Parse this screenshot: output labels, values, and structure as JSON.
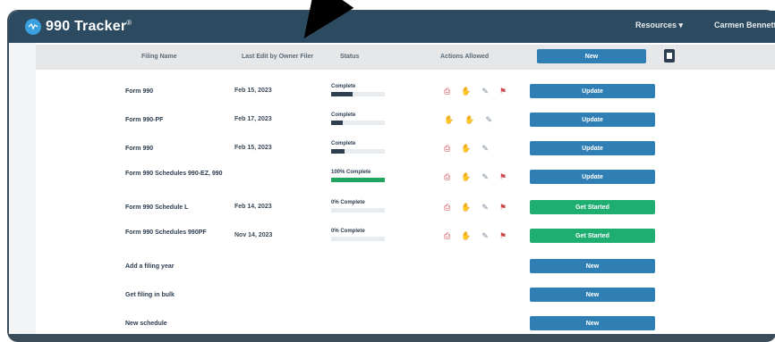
{
  "app": {
    "title": "990 Tracker",
    "registered_mark": "®"
  },
  "nav": {
    "resources": "Resources ▾",
    "account": "Carmen Bennett ▾"
  },
  "table": {
    "headers": [
      "Filing Name",
      "Last Edit by Owner Filer",
      "Status",
      "Actions Allowed",
      ""
    ],
    "header_button": "New",
    "rows": [
      {
        "form": "Form 990",
        "date": "Feb 15, 2023",
        "status": "Complete",
        "progress": 0.4,
        "progress_color": "#2c3e50",
        "icons": [
          "pdf-icon",
          "hand-icon",
          "edit-icon",
          "flag-icon"
        ],
        "action": "Update",
        "action_color": "#2f7fb4"
      },
      {
        "form": "Form 990-PF",
        "date": "Feb 17, 2023",
        "status": "Complete",
        "progress": 0.22,
        "progress_color": "#2c3e50",
        "icons": [
          "hand-icon",
          "hand-icon",
          "edit-icon"
        ],
        "action": "Update",
        "action_color": "#2f7fb4"
      },
      {
        "form": "Form 990",
        "date": "Feb 15, 2023",
        "status": "Complete",
        "progress": 0.25,
        "progress_color": "#2c3e50",
        "icons": [
          "pdf-icon",
          "hand-icon",
          "edit-icon"
        ],
        "action": "Update",
        "action_color": "#2f7fb4"
      },
      {
        "form": "Form 990 Schedules 990-EZ, 990",
        "date": "",
        "status": "100% Complete",
        "progress": 1.0,
        "progress_color": "#22a65f",
        "icons": [
          "pdf-icon",
          "hand-icon",
          "edit-icon",
          "flag-icon"
        ],
        "action": "Update",
        "action_color": "#2f7fb4"
      },
      {
        "form": "Form 990 Schedule L",
        "date": "Feb 14, 2023",
        "status": "0% Complete",
        "progress": 0.0,
        "progress_color": "#2c3e50",
        "icons": [
          "pdf-icon",
          "hand-icon",
          "edit-icon",
          "flag-icon"
        ],
        "action": "Get Started",
        "action_color": "#1fae72"
      },
      {
        "form": "Form 990 Schedules 990PF",
        "date": "Nov 14, 2023",
        "status": "0% Complete",
        "progress": 0.0,
        "progress_color": "#2c3e50",
        "icons": [
          "pdf-icon",
          "hand-icon",
          "edit-icon",
          "flag-icon"
        ],
        "action": "Get Started",
        "action_color": "#1fae72"
      },
      {
        "form": "Add a filing year",
        "date": "",
        "status": "",
        "progress": null,
        "icons": [],
        "action": "New",
        "action_color": "#2f7fb4"
      },
      {
        "form": "Get filing in bulk",
        "date": "",
        "status": "",
        "progress": null,
        "icons": [],
        "action": "New",
        "action_color": "#2f7fb4"
      },
      {
        "form": "New schedule",
        "date": "",
        "status": "",
        "progress": null,
        "icons": [],
        "action": "New",
        "action_color": "#2f7fb4"
      }
    ]
  },
  "icon_glyphs": {
    "pdf-icon": "⎙",
    "hand-icon": "✋",
    "edit-icon": "✎",
    "flag-icon": "⚑"
  }
}
